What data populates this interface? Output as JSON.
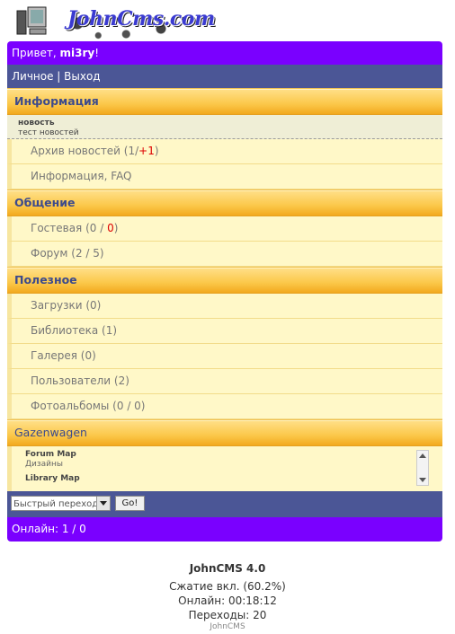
{
  "logo": {
    "text": "JohnCms.com"
  },
  "greeting": {
    "prefix": "Привет, ",
    "user": "mi3ry",
    "suffix": "!"
  },
  "usernav": {
    "personal": "Личное",
    "sep": " | ",
    "logout": "Выход"
  },
  "sections": {
    "info": {
      "title": "Информация",
      "news_title": "новость",
      "news_text": "тест новостей",
      "archive": {
        "label": "Архив новостей (1/",
        "new": "+1",
        "close": ")"
      },
      "faq": "Информация, FAQ"
    },
    "social": {
      "title": "Общение",
      "guest": {
        "label": "Гостевая (0 / ",
        "count": "0",
        "close": ")"
      },
      "forum": "Форум (2 / 5)"
    },
    "useful": {
      "title": "Полезное",
      "items": [
        "Загрузки (0)",
        "Библиотека (1)",
        "Галерея (0)",
        "Пользователи (2)",
        "Фотоальбомы (0 / 0)"
      ]
    },
    "gaz": {
      "title": "Gazenwagen",
      "entries": [
        {
          "title": "Forum Map",
          "sub": "Дизайны"
        },
        {
          "title": "Library Map",
          "sub": ""
        }
      ]
    }
  },
  "quickjump": {
    "select_value": "Быстрый переход",
    "go": "Go!"
  },
  "online": "Онлайн: 1 / 0",
  "footer": {
    "name": "JohnCMS 4.0",
    "compression": "Сжатие вкл. (60.2%)",
    "online_time": "Онлайн: 00:18:12",
    "transitions": "Переходы: 20",
    "copyright": "JohnCMS"
  }
}
